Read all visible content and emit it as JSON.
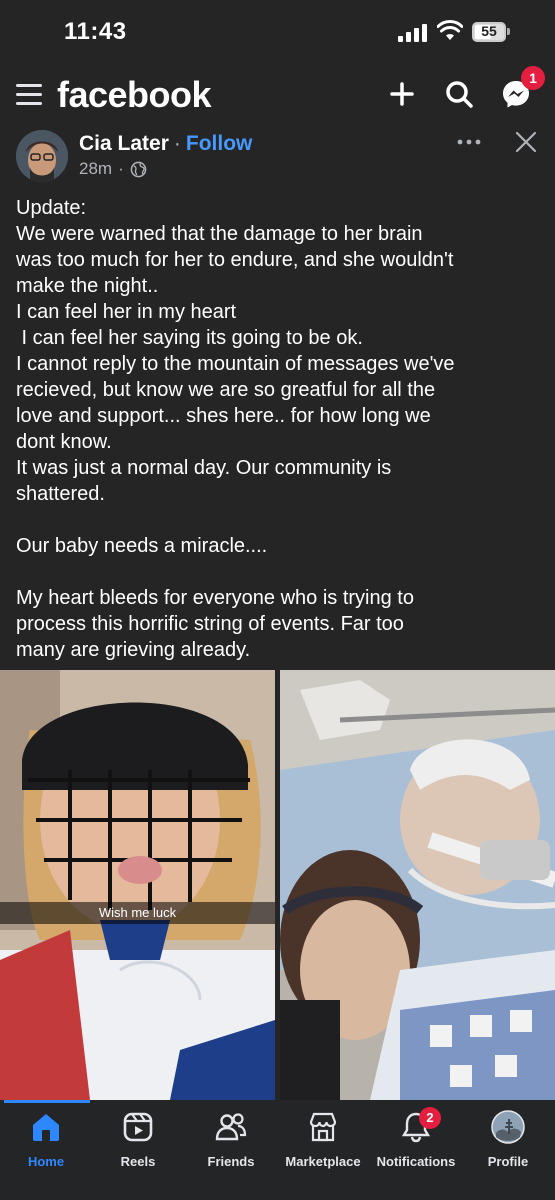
{
  "status_bar": {
    "time": "11:43",
    "battery_level": "55"
  },
  "header": {
    "logo": "facebook",
    "icons": [
      "menu-icon",
      "plus-icon",
      "search-icon",
      "messenger-icon"
    ],
    "messenger_badge": "1"
  },
  "post": {
    "author": "Cia Later",
    "separator": "·",
    "follow_label": "Follow",
    "time_ago": "28m",
    "meta_separator": "·",
    "audience_icon": "globe-icon",
    "text_lines": [
      "Update:",
      "We were warned that the damage to her brain",
      "was too much for her to endure, and she wouldn't",
      "make the night..",
      "I can feel her in my heart",
      " I can feel her saying its going to be ok.",
      "I cannot reply to the mountain of messages we've",
      "recieved, but know we are so greatful for all the",
      "love and support... shes here.. for how long we",
      "dont know.",
      "It was just a normal day. Our community is",
      "shattered.",
      "",
      "Our baby needs a miracle....",
      "",
      "My heart bleeds for everyone who is trying to",
      "process this horrific string of events. Far too",
      "many are grieving already."
    ],
    "photo_caption": "Wish me luck"
  },
  "bottom_nav": {
    "items": [
      {
        "label": "Home",
        "icon": "home-icon",
        "active": true
      },
      {
        "label": "Reels",
        "icon": "reels-icon"
      },
      {
        "label": "Friends",
        "icon": "friends-icon"
      },
      {
        "label": "Marketplace",
        "icon": "marketplace-icon"
      },
      {
        "label": "Notifications",
        "icon": "bell-icon"
      },
      {
        "label": "Profile",
        "icon": "profile-avatar"
      }
    ],
    "notifications_badge": "2"
  },
  "colors": {
    "background": "#252526",
    "accent_blue": "#2d88ff",
    "follow_blue": "#4599ff",
    "badge_red": "#e41e3f"
  }
}
